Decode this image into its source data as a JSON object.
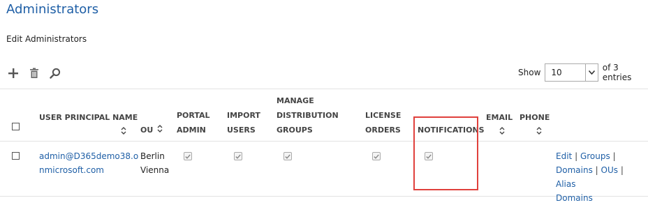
{
  "page": {
    "title": "Administrators",
    "subtitle": "Edit Administrators"
  },
  "toolbar": {
    "add_icon": "plus-icon",
    "delete_icon": "trash-icon",
    "search_icon": "search-icon"
  },
  "paging": {
    "show_label": "Show",
    "page_size": "10",
    "entries_text": "of 3 entries"
  },
  "table": {
    "columns": {
      "upn": [
        "USER PRINCIPAL NAME"
      ],
      "ou": [
        "OU"
      ],
      "portal_admin": [
        "PORTAL",
        "ADMIN"
      ],
      "import_users": [
        "IMPORT",
        "USERS"
      ],
      "manage_dist": [
        "MANAGE",
        "DISTRIBUTION",
        "GROUPS"
      ],
      "license_orders": [
        "LICENSE",
        "ORDERS"
      ],
      "notifications": [
        "NOTIFICATIONS"
      ],
      "email": [
        "EMAIL"
      ],
      "phone": [
        "PHONE"
      ]
    },
    "rows": [
      {
        "upn_lines": [
          "admin@D365demo38.o",
          "nmicrosoft.com"
        ],
        "ou_lines": [
          "Berlin",
          "Vienna"
        ],
        "portal_admin": true,
        "import_users": true,
        "manage_dist": true,
        "license_orders": true,
        "notifications": true,
        "email": "",
        "phone": "",
        "actions": {
          "edit": "Edit",
          "groups": "Groups",
          "domains": "Domains",
          "ous": "OUs",
          "alias_domains": "Alias Domains",
          "separator": "|"
        }
      }
    ]
  },
  "colors": {
    "accent": "#1f5fa6",
    "highlight_border": "#e0403c"
  }
}
